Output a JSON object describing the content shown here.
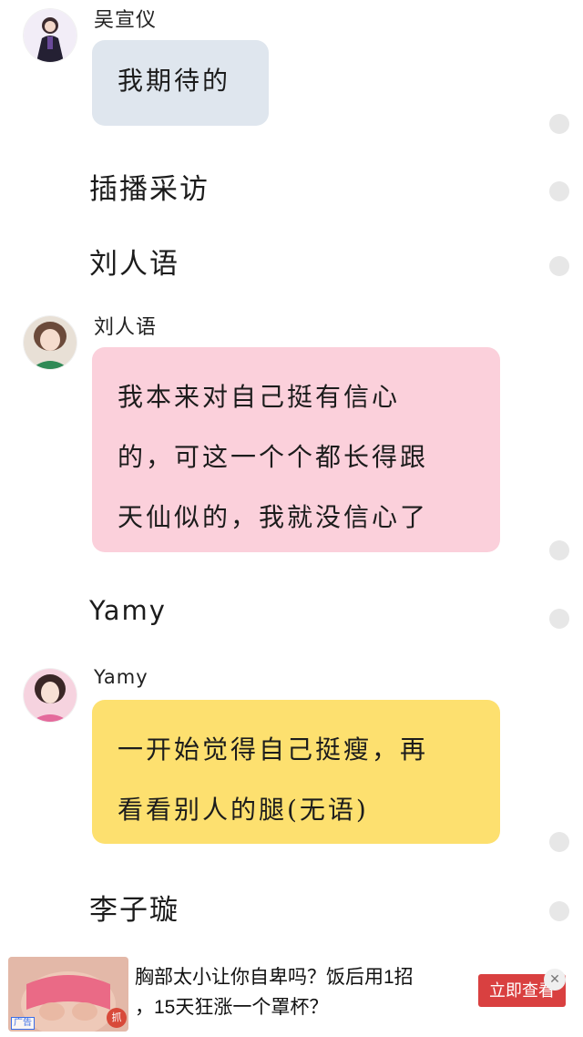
{
  "messages": [
    {
      "sender": "吴宣仪",
      "lines": [
        "我期待的"
      ],
      "bubble_color": "#dfe6ee"
    },
    {
      "sender": "刘人语",
      "lines": [
        "我本来对自己挺有信心",
        "的，可这一个个都长得跟",
        "天仙似的，我就没信心了"
      ],
      "bubble_color": "#fbd0db"
    },
    {
      "sender": "Yamy",
      "lines": [
        "一开始觉得自己挺瘦，再",
        "看看别人的腿(无语)"
      ],
      "bubble_color": "#fde06f"
    }
  ],
  "captions": [
    "插播采访",
    "刘人语",
    "Yamy",
    "李子璇"
  ],
  "ad": {
    "text_lines": [
      "胸部太小让你自卑吗？饭后用1招",
      "，15天狂涨一个罩杯？"
    ],
    "button_label": "立即查看",
    "tag": "广告",
    "grab_label": "抓",
    "close_icon": "close-icon",
    "button_color": "#d94040"
  }
}
